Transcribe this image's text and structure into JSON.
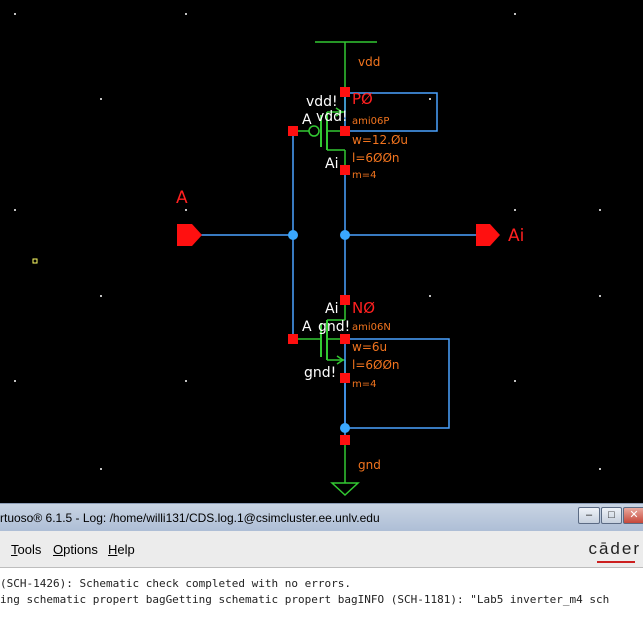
{
  "schematic": {
    "nets": {
      "vdd": "vdd",
      "gnd": "gnd",
      "input_pin": "A",
      "output_pin": "Ai"
    },
    "pmos": {
      "instance": "PØ",
      "model": "ami06P",
      "w": "w=12.Øu",
      "l": "l=6ØØn",
      "m": "m=4",
      "gate_label": "A",
      "bulk_label": "vdd!",
      "top_label": "vdd!",
      "drain_label": "Ai"
    },
    "nmos": {
      "instance": "NØ",
      "model": "ami06N",
      "w": "w=6u",
      "l": "l=6ØØn",
      "m": "m=4",
      "gate_label": "A",
      "bulk_label": "gnd!",
      "bottom_label": "gnd!",
      "drain_label": "Ai"
    },
    "colors": {
      "background": "#000000",
      "wire": "#4aa3ff",
      "pin": "#ff1010",
      "device": "#32c832",
      "text": "#ffffff",
      "param": "#f2741e"
    }
  },
  "window": {
    "title": "rtuoso® 6.1.5 - Log: /home/willi131/CDS.log.1@csimcluster.ee.unlv.edu",
    "buttons": {
      "minimize": "–",
      "maximize": "□",
      "close": "✕"
    }
  },
  "menubar": {
    "items": [
      {
        "label": "Tools",
        "mnemonic": "T",
        "rest": "ools"
      },
      {
        "label": "Options",
        "mnemonic": "O",
        "rest": "ptions"
      },
      {
        "label": "Help",
        "mnemonic": "H",
        "rest": "elp"
      }
    ],
    "brand": "cāder"
  },
  "log": {
    "lines": [
      " (SCH-1426): Schematic check completed with no errors.",
      "ing schematic propert bagGetting schematic propert bagINFO (SCH-1181): \"Lab5 inverter_m4 sch"
    ]
  }
}
